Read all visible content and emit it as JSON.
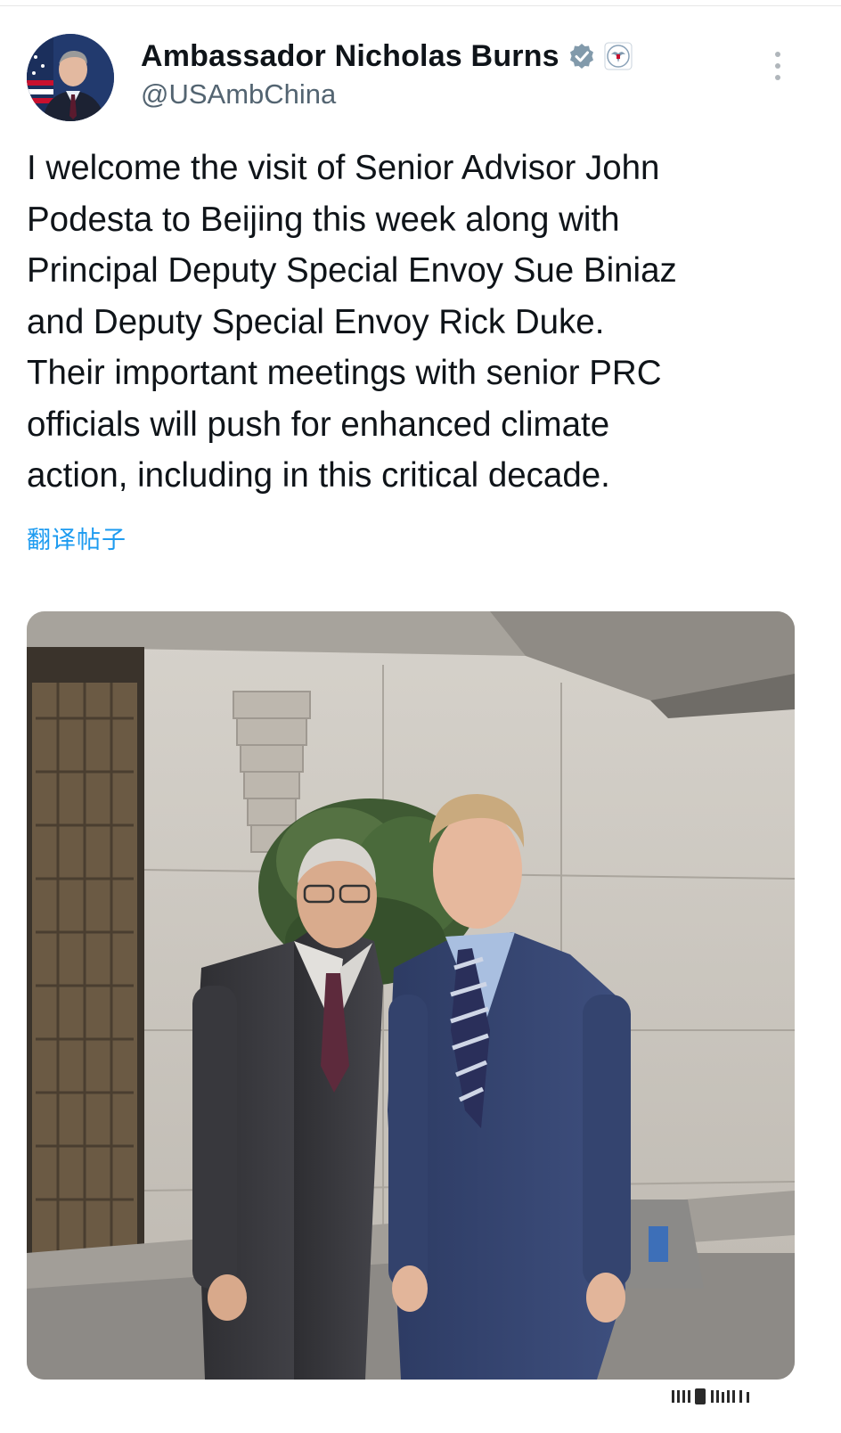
{
  "tweet": {
    "author_name": "Ambassador Nicholas Burns",
    "handle": "@USAmbChina",
    "text_lines": [
      "I welcome the visit of Senior Advisor John",
      "Podesta to Beijing this week along with",
      "Principal Deputy Special Envoy Sue Biniaz",
      "and Deputy Special Envoy Rick Duke.",
      "Their important meetings with senior PRC",
      "officials will push for enhanced climate",
      "action, including in this critical decade."
    ],
    "translate_label": "翻译帖子"
  },
  "icons": {
    "verified": "verified-badge-icon",
    "affiliation": "us-state-department-seal-icon",
    "more": "more-vertical-icon"
  },
  "colors": {
    "text": "#0f1419",
    "secondary": "#536471",
    "link": "#1d9bf0",
    "badge": "#829aab"
  }
}
